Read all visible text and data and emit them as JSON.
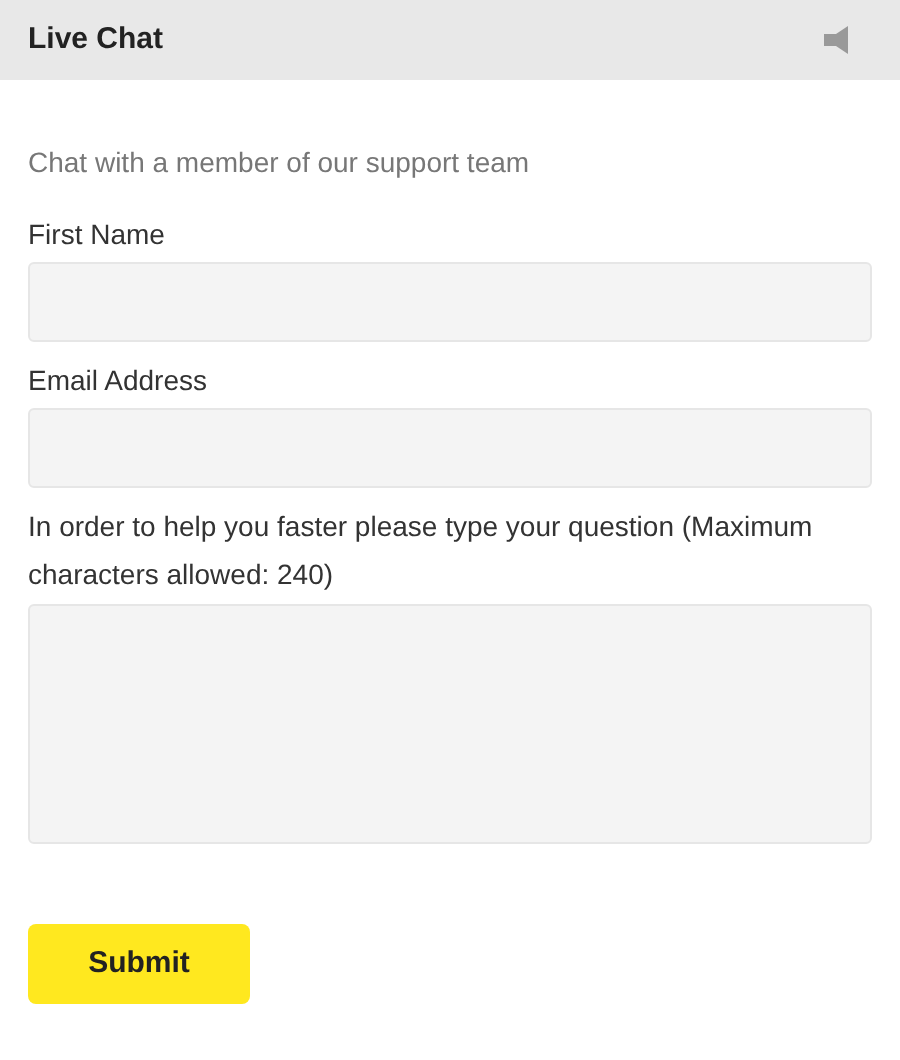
{
  "header": {
    "title": "Live Chat"
  },
  "intro": "Chat with a member of our support team",
  "fields": [
    {
      "kind": "input",
      "label": "First Name"
    },
    {
      "kind": "input",
      "label": "Email Address"
    },
    {
      "kind": "textarea",
      "label": "In order to help you faster please type your question (Maximum characters allowed: 240)"
    }
  ],
  "submit": "Submit"
}
